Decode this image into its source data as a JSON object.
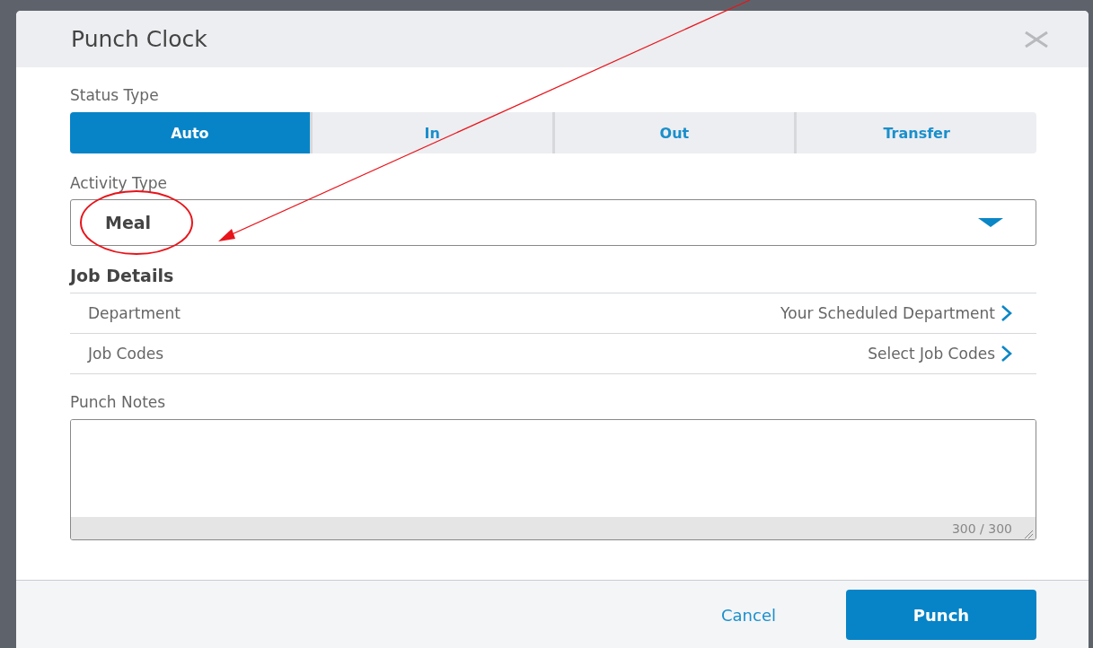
{
  "modal": {
    "title": "Punch Clock"
  },
  "status_type": {
    "label": "Status Type",
    "options": [
      {
        "label": "Auto",
        "selected": true
      },
      {
        "label": "In",
        "selected": false
      },
      {
        "label": "Out",
        "selected": false
      },
      {
        "label": "Transfer",
        "selected": false
      }
    ]
  },
  "activity_type": {
    "label": "Activity Type",
    "value": "Meal"
  },
  "job_details": {
    "title": "Job Details",
    "rows": [
      {
        "label": "Department",
        "value": "Your Scheduled Department"
      },
      {
        "label": "Job Codes",
        "value": "Select Job Codes"
      }
    ]
  },
  "punch_notes": {
    "label": "Punch Notes",
    "counter": "300 / 300"
  },
  "buttons": {
    "cancel": "Cancel",
    "punch": "Punch"
  }
}
